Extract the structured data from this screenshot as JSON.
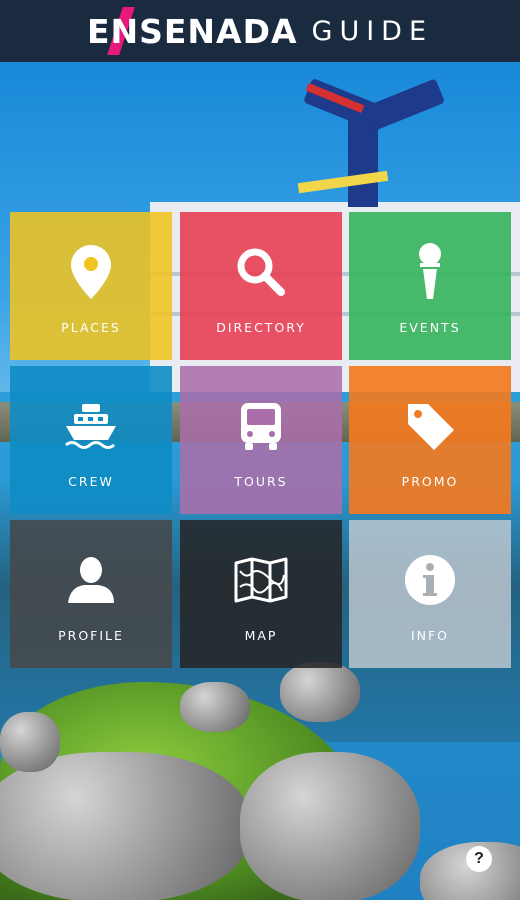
{
  "header": {
    "brand_first": "E",
    "brand_n": "N",
    "brand_rest": "SENADA",
    "brand_suffix": "GUIDE",
    "accent_color": "#e8197d",
    "background_color": "#1a2b40"
  },
  "tiles": [
    {
      "label": "PLACES",
      "icon": "map-pin-icon",
      "color": "rgba(240,196,32,0.88)"
    },
    {
      "label": "DIRECTORY",
      "icon": "magnifier-icon",
      "color": "rgba(232,62,84,0.9)"
    },
    {
      "label": "EVENTS",
      "icon": "microphone-icon",
      "color": "rgba(52,178,92,0.9)"
    },
    {
      "label": "CREW",
      "icon": "boat-icon",
      "color": "rgba(14,140,196,0.9)"
    },
    {
      "label": "TOURS",
      "icon": "bus-icon",
      "color": "rgba(170,110,170,0.88)"
    },
    {
      "label": "PROMO",
      "icon": "price-tag-icon",
      "color": "rgba(242,122,32,0.92)"
    },
    {
      "label": "PROFILE",
      "icon": "person-icon",
      "color": "rgba(70,72,74,0.88)"
    },
    {
      "label": "MAP",
      "icon": "folded-map-icon",
      "color": "rgba(38,38,40,0.88)"
    },
    {
      "label": "INFO",
      "icon": "info-icon",
      "color": "rgba(200,205,212,0.78)"
    }
  ],
  "help_button": {
    "label": "?"
  }
}
